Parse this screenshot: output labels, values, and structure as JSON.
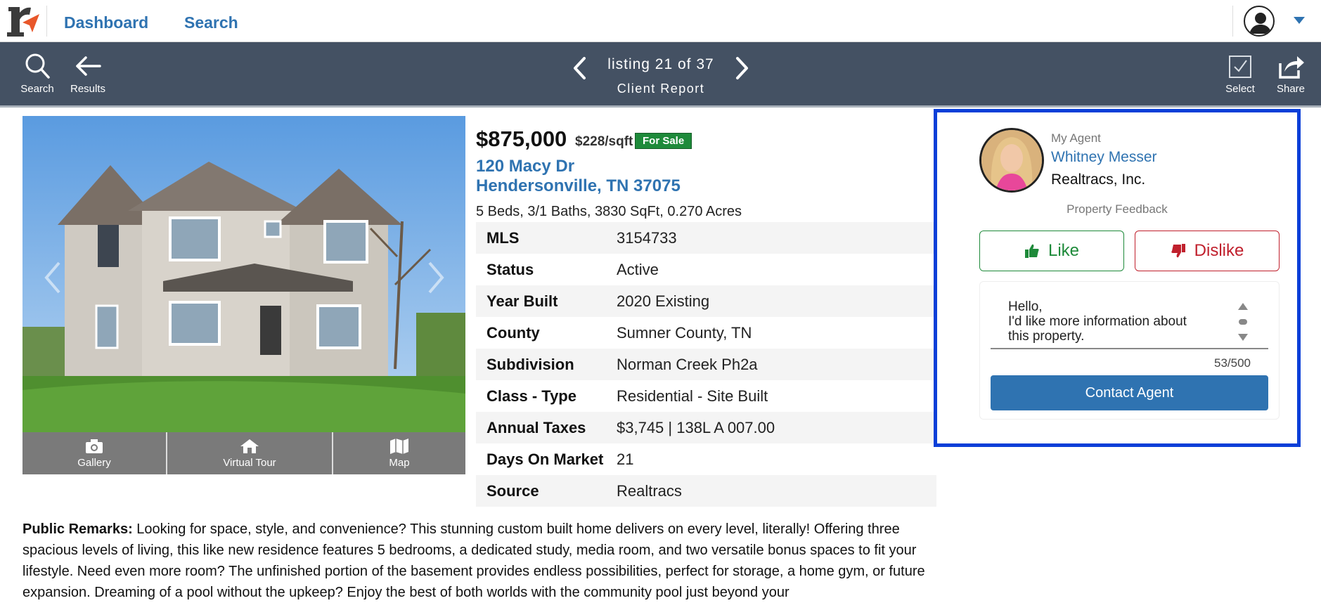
{
  "topnav": {
    "dashboard_label": "Dashboard",
    "search_label": "Search"
  },
  "toolbar": {
    "search_label": "Search",
    "results_label": "Results",
    "listing_counter": "listing 21 of 37",
    "report_label": "Client Report",
    "select_label": "Select",
    "share_label": "Share"
  },
  "photo": {
    "tabs": [
      {
        "label": "Gallery",
        "icon": "camera-icon"
      },
      {
        "label": "Virtual Tour",
        "icon": "house-tour-icon"
      },
      {
        "label": "Map",
        "icon": "map-icon"
      }
    ]
  },
  "listing": {
    "price": "$875,000",
    "price_per_sqft": "$228/sqft",
    "status_badge": "For Sale",
    "address_line1": "120 Macy Dr",
    "address_line2": "Hendersonville, TN 37075",
    "summary": "5 Beds, 3/1 Baths, 3830 SqFt, 0.270 Acres",
    "facts": [
      {
        "label": "MLS",
        "value": "3154733"
      },
      {
        "label": "Status",
        "value": "Active"
      },
      {
        "label": "Year Built",
        "value": "2020 Existing"
      },
      {
        "label": "County",
        "value": "Sumner County, TN"
      },
      {
        "label": "Subdivision",
        "value": "Norman Creek Ph2a"
      },
      {
        "label": "Class - Type",
        "value": "Residential - Site Built"
      },
      {
        "label": "Annual Taxes",
        "value": "$3,745 | 138L A 007.00"
      },
      {
        "label": "Days On Market",
        "value": "21"
      },
      {
        "label": "Source",
        "value": "Realtracs"
      }
    ]
  },
  "agent": {
    "heading": "My Agent",
    "name": "Whitney Messer",
    "company": "Realtracs, Inc.",
    "feedback_label": "Property Feedback",
    "like_label": "Like",
    "dislike_label": "Dislike",
    "message": "Hello,\nI'd like more information about\nthis property.",
    "char_count": "53/500",
    "contact_label": "Contact Agent"
  },
  "remarks": {
    "label": "Public Remarks:",
    "text": " Looking for space, style, and convenience? This stunning custom built home delivers on every level, literally! Offering three spacious levels of living, this like new residence features 5 bedrooms, a dedicated study, media room, and two versatile bonus spaces to fit your lifestyle. Need even more room? The unfinished portion of the basement provides endless possibilities, perfect for storage, a home gym, or future expansion. Dreaming of a pool without the upkeep? Enjoy the best of both worlds with the community pool just beyond your"
  },
  "colors": {
    "brand_blue": "#2f73b1",
    "toolbar_bg": "#445163",
    "for_sale_green": "#1e8a3a",
    "dislike_red": "#c0202d",
    "highlight_border": "#0a3fd8"
  }
}
